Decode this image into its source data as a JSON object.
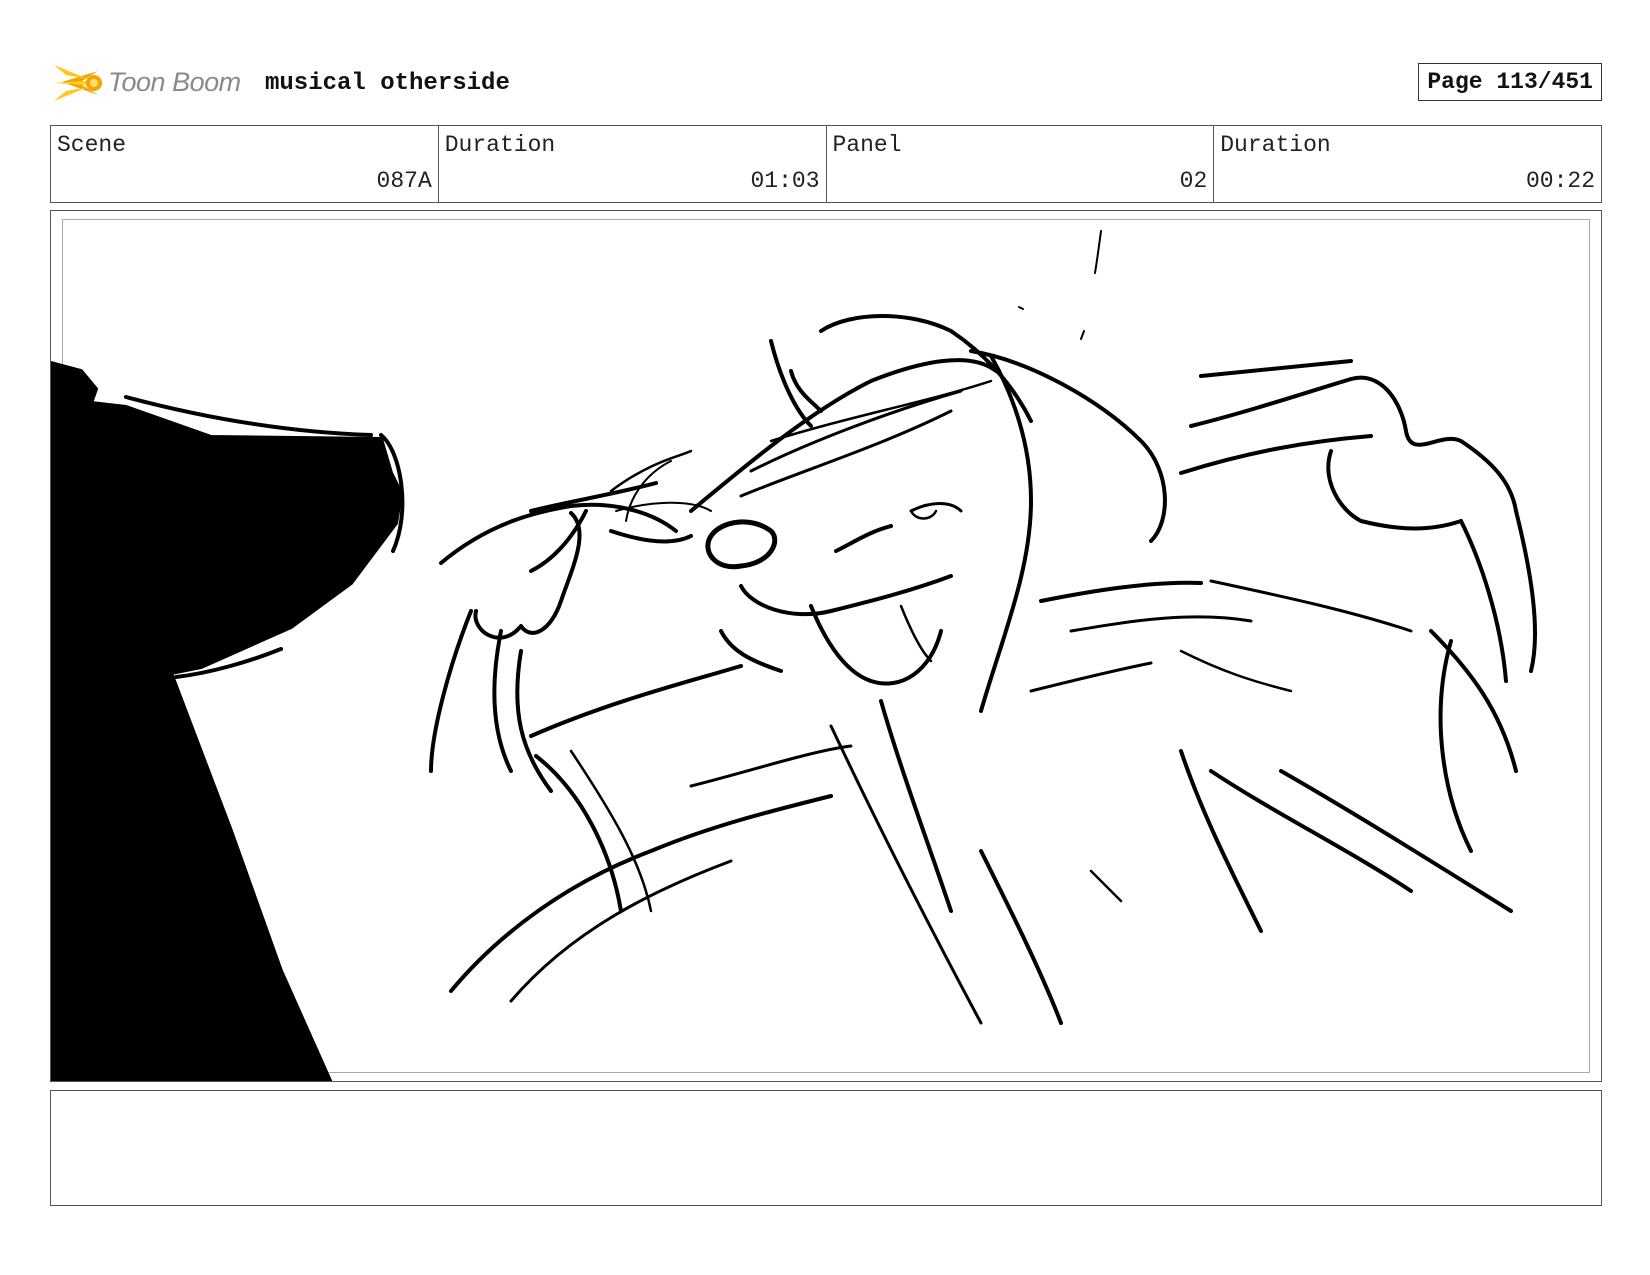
{
  "header": {
    "logo_text": "Toon Boom",
    "project_title": "musical otherside",
    "page_label": "Page 113/451"
  },
  "info": {
    "scene_label": "Scene",
    "scene_value": "087A",
    "scene_duration_label": "Duration",
    "scene_duration_value": "01:03",
    "panel_label": "Panel",
    "panel_value": "02",
    "panel_duration_label": "Duration",
    "panel_duration_value": "00:22"
  },
  "notes": {
    "text": ""
  },
  "colors": {
    "logo_orange": "#f5a300",
    "logo_yellow": "#ffd21f",
    "logo_gray": "#8a8a8a",
    "ink": "#000000",
    "border": "#555555"
  }
}
